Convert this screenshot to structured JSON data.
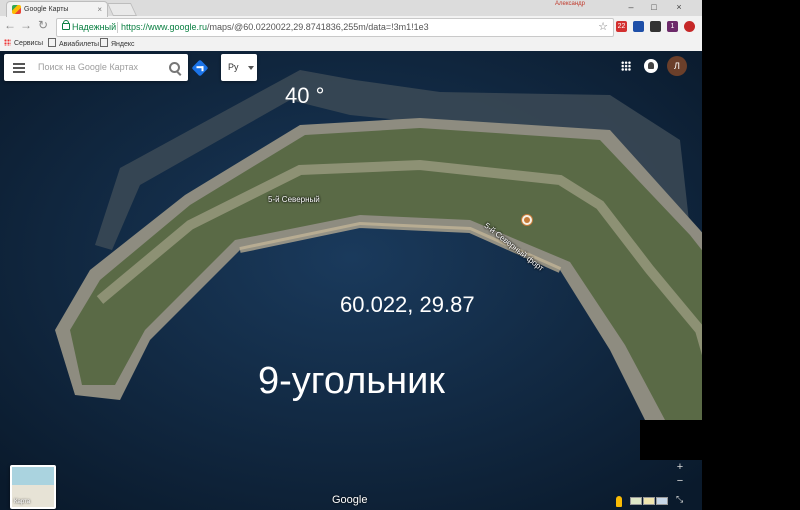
{
  "browser": {
    "tab_title": "Google Карты",
    "tab_close": "×",
    "user_name": "Александр",
    "window_controls": [
      "–",
      "□",
      "×"
    ],
    "nav_icons": [
      "←",
      "→",
      "↻"
    ],
    "secure_label": "Надежный",
    "url_base": "https://www.google.ru",
    "url_path": "/maps/@60.0220022,29.8741836,255m/data=!3m1!1e3",
    "star_icon": "☆",
    "bookmarks": [
      "Сервисы",
      "Авиабилеты",
      "Яндекс"
    ],
    "extension_badges": [
      "22",
      "1"
    ]
  },
  "maps_ui": {
    "search_placeholder": "Поиск на Google Картах",
    "language_label": "Ру",
    "avatar_letter": "Л",
    "thumbnail_label": "Карта",
    "brand": "Google",
    "zoom_in": "+",
    "zoom_out": "−",
    "fullscreen_icon": "⤡"
  },
  "map_labels": {
    "place_1": "5-й Северный",
    "place_2": "5-й Северный форт"
  },
  "overlay": {
    "angle": "40 °",
    "coordinates": "60.022, 29.87",
    "shape_name": "9-угольник"
  },
  "colors": {
    "water": "#0d2136",
    "land": "#5a6a46",
    "wall": "#b8b09a",
    "accent_green": "#0b8043",
    "accent_blue": "#1a73e8"
  }
}
